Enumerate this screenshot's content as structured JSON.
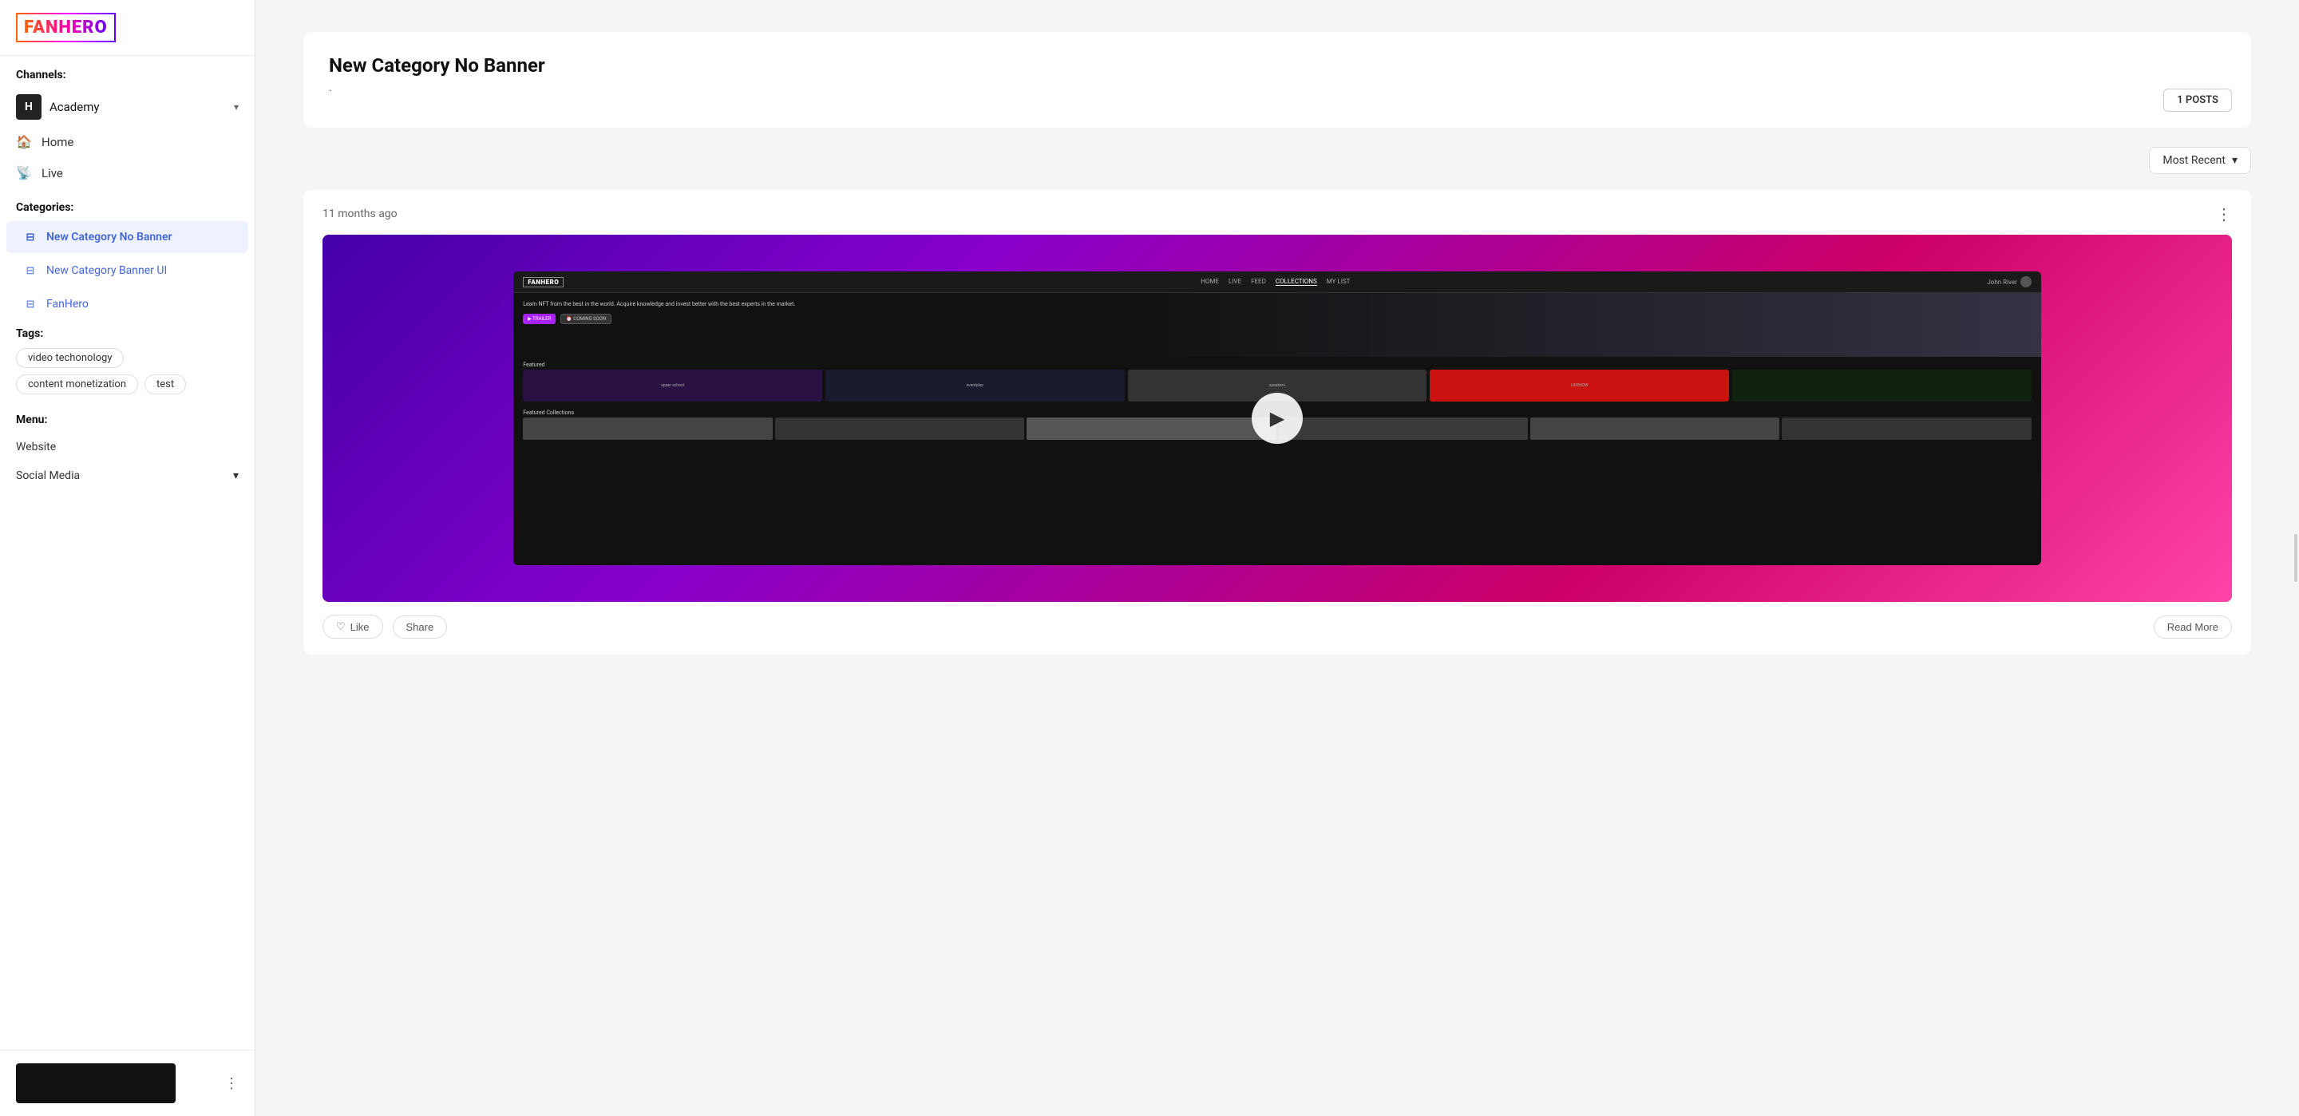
{
  "sidebar": {
    "logo": "FANHERO",
    "channels_label": "Channels:",
    "channel": {
      "name": "Academy",
      "icon": "H"
    },
    "nav_items": [
      {
        "id": "home",
        "label": "Home",
        "icon": "🏠"
      },
      {
        "id": "live",
        "label": "Live",
        "icon": "📡"
      }
    ],
    "categories_label": "Categories:",
    "categories": [
      {
        "id": "new-category-no-banner",
        "label": "New Category No Banner",
        "active": true
      },
      {
        "id": "new-category-banner-ui",
        "label": "New Category Banner UI",
        "active": false
      },
      {
        "id": "fanhero",
        "label": "FanHero",
        "active": false
      }
    ],
    "tags_label": "Tags:",
    "tags": [
      "video techonology",
      "content monetization",
      "test"
    ],
    "menu_label": "Menu:",
    "menu_items": [
      {
        "id": "website",
        "label": "Website"
      }
    ],
    "social_media": "Social Media",
    "bottom_dots": "⋮"
  },
  "main": {
    "category": {
      "title": "New Category No Banner",
      "subtitle": ".",
      "posts_count": "1 POSTS"
    },
    "filter": {
      "label": "Most Recent",
      "icon": "▾"
    },
    "posts": [
      {
        "timestamp": "11 months ago",
        "has_video": true,
        "inner_app": {
          "logo": "FANHERO",
          "nav_links": [
            "HOME",
            "LIVE",
            "FEED",
            "COLLECTIONS",
            "MY LIST"
          ],
          "user": "John River",
          "hero_text": "Learn NFT from the best in the world. Acquire knowledge and invest better with the best experts in the market.",
          "btn_trailer": "▶ TRAILER",
          "btn_coming_soon": "⏰ COMING SOON",
          "featured_label": "Featured",
          "featured_cards": [
            "upper school",
            "eventplay",
            "speaker+",
            "LIDENOW",
            ""
          ],
          "collections_label": "Featured Collections"
        }
      }
    ]
  },
  "icons": {
    "home": "⌂",
    "live": "◉",
    "category": "▦",
    "chevron_down": "▾",
    "play": "▶",
    "like": "♡",
    "comment": "💬",
    "share": "↗",
    "more_vert": "⋮"
  }
}
